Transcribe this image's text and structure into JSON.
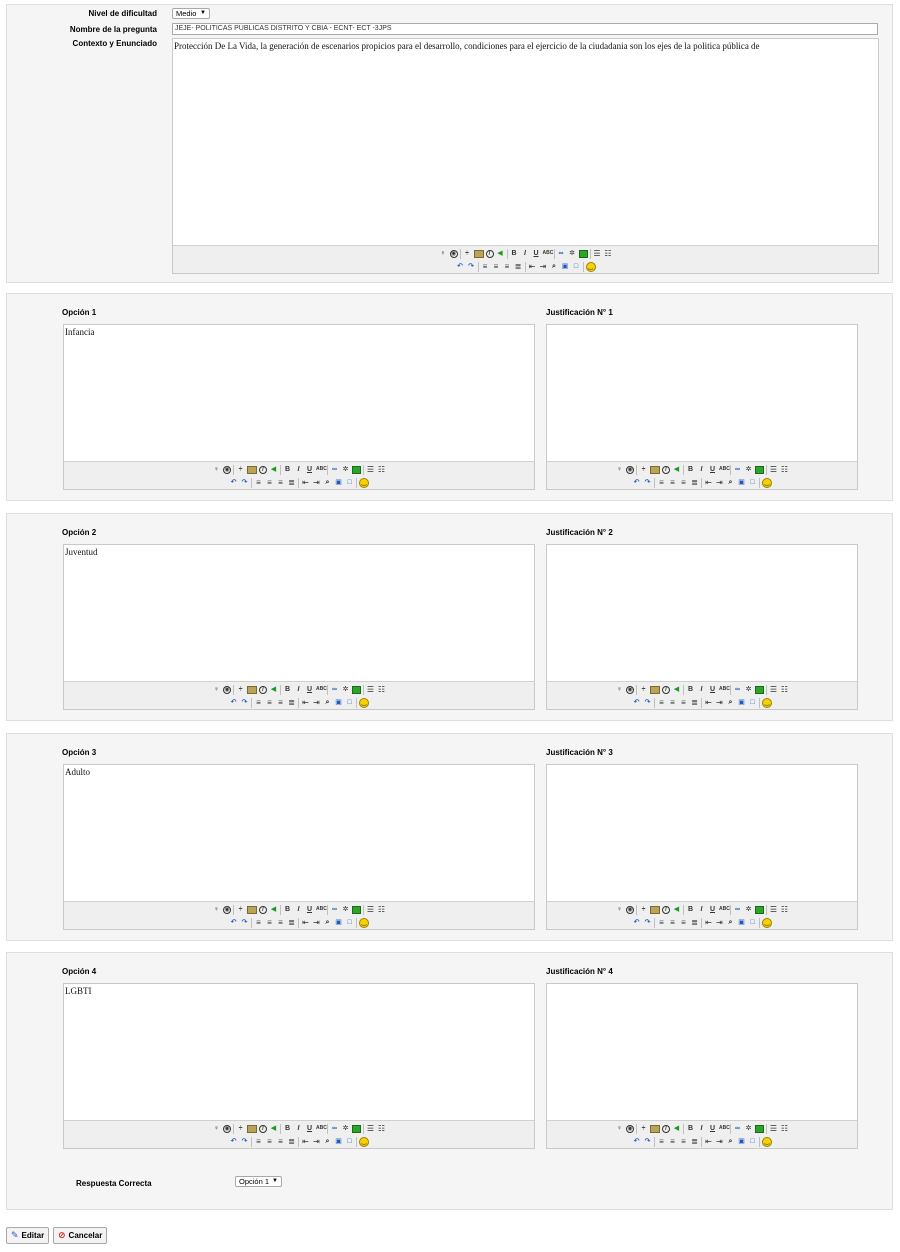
{
  "question": {
    "difficulty_label": "Nivel de dificultad",
    "difficulty_value": "Medio",
    "name_label": "Nombre de la pregunta",
    "name_value": "JEJE- POLITICAS PÚBLICAS DISTRITO Y CBIA - ECNT- ECT -3JPS",
    "context_label": "Contexto y Enunciado",
    "context_text": "Protección De La Vida, la generación de escenarios propicios para el desarrollo, condiciones para el ejercicio de la ciudadania son los ejes de la politica pública de"
  },
  "options": [
    {
      "label": "Opción 1",
      "text": "Infancia",
      "just_label": "Justificación N° 1",
      "just_text": ""
    },
    {
      "label": "Opción 2",
      "text": "Juventud",
      "just_label": "Justificación N° 2",
      "just_text": ""
    },
    {
      "label": "Opción 3",
      "text": "Adulto",
      "just_label": "Justificación N° 3",
      "just_text": ""
    },
    {
      "label": "Opción 4",
      "text": "LGBTI",
      "just_label": "Justificación N° 4",
      "just_text": ""
    }
  ],
  "answer": {
    "label": "Respuesta Correcta",
    "value": "Opción 1"
  },
  "toolbar": {
    "icons_row1": [
      "microphone-icon",
      "audio-icon",
      "separator",
      "strike-icon",
      "image-icon",
      "flash-icon",
      "sound-icon",
      "separator",
      "bold-icon",
      "italic-icon",
      "underline-icon",
      "spellcheck-icon",
      "separator",
      "link-icon",
      "unlink-icon",
      "table-icon",
      "separator",
      "bullet-list-icon",
      "numbered-list-icon"
    ],
    "icons_row2": [
      "undo-icon",
      "redo-icon",
      "separator",
      "align-left-icon",
      "align-center-icon",
      "align-right-icon",
      "justify-icon",
      "separator",
      "outdent-icon",
      "indent-icon",
      "preview-icon",
      "paste-icon",
      "paste-word-icon",
      "separator",
      "smiley-icon"
    ],
    "glyphs": {
      "bold": "B",
      "italic": "I",
      "underline": "U",
      "spell": "ABC"
    }
  },
  "buttons": {
    "edit": "Editar",
    "cancel": "Cancelar"
  },
  "colors": {
    "panel_bg": "#f5f5f5",
    "toolbar_bg": "#efefef",
    "edit_icon": "#2a56c6",
    "cancel_icon": "#d21f1f"
  }
}
